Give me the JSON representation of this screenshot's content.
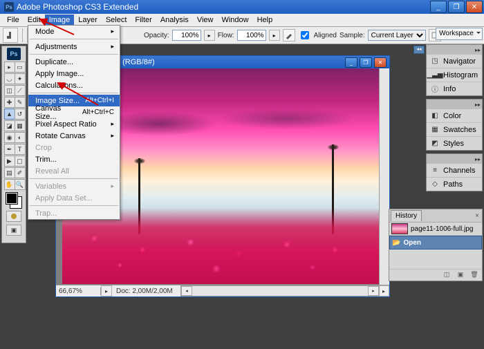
{
  "app": {
    "title": "Adobe Photoshop CS3 Extended"
  },
  "menubar": [
    "File",
    "Edit",
    "Image",
    "Layer",
    "Select",
    "Filter",
    "Analysis",
    "View",
    "Window",
    "Help"
  ],
  "image_menu": {
    "mode": "Mode",
    "adjustments": "Adjustments",
    "duplicate": "Duplicate...",
    "apply_image": "Apply Image...",
    "calculations": "Calculations...",
    "image_size": "Image Size...",
    "image_size_sc": "Alt+Ctrl+I",
    "canvas_size": "Canvas Size...",
    "canvas_size_sc": "Alt+Ctrl+C",
    "pixel_aspect": "Pixel Aspect Ratio",
    "rotate_canvas": "Rotate Canvas",
    "crop": "Crop",
    "trim": "Trim...",
    "reveal_all": "Reveal All",
    "variables": "Variables",
    "apply_data": "Apply Data Set...",
    "trap": "Trap..."
  },
  "options": {
    "opacity_label": "Opacity:",
    "opacity_value": "100%",
    "flow_label": "Flow:",
    "flow_value": "100%",
    "aligned_label": "Aligned",
    "sample_label": "Sample:",
    "sample_value": "Current Layer",
    "workspace_label": "Workspace"
  },
  "document": {
    "title": "ll.jpg @ 66,7% (RGB/8#)",
    "zoom": "66,67%",
    "doc_info": "Doc: 2,00M/2,00M"
  },
  "panels": {
    "navigator": "Navigator",
    "histogram": "Histogram",
    "info": "Info",
    "color": "Color",
    "swatches": "Swatches",
    "styles": "Styles",
    "channels": "Channels",
    "paths": "Paths"
  },
  "history": {
    "tab": "History",
    "file": "page11-1006-full.jpg",
    "open": "Open"
  }
}
